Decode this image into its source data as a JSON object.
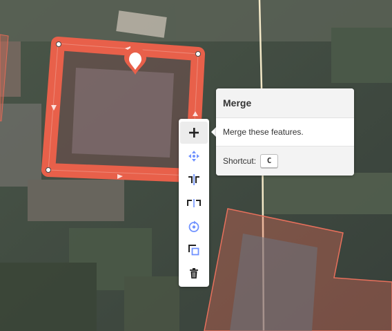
{
  "colors": {
    "selected_area": "#e8604a",
    "area_fill": "#e06a56",
    "path_line": "#f4e9c8",
    "toolbar_bg": "#ffffff",
    "icon_blue": "#7092ff"
  },
  "edit_menu": {
    "tools": [
      {
        "name": "merge",
        "icon": "plus-icon",
        "active": true
      },
      {
        "name": "move",
        "icon": "move-icon"
      },
      {
        "name": "split",
        "icon": "split-icon"
      },
      {
        "name": "disconnect",
        "icon": "disconnect-icon"
      },
      {
        "name": "rotate",
        "icon": "rotate-icon"
      },
      {
        "name": "copy",
        "icon": "copy-icon"
      },
      {
        "name": "delete",
        "icon": "trash-icon"
      }
    ]
  },
  "tooltip": {
    "title": "Merge",
    "description": "Merge these features.",
    "shortcut_label": "Shortcut:",
    "shortcut_key": "C"
  }
}
